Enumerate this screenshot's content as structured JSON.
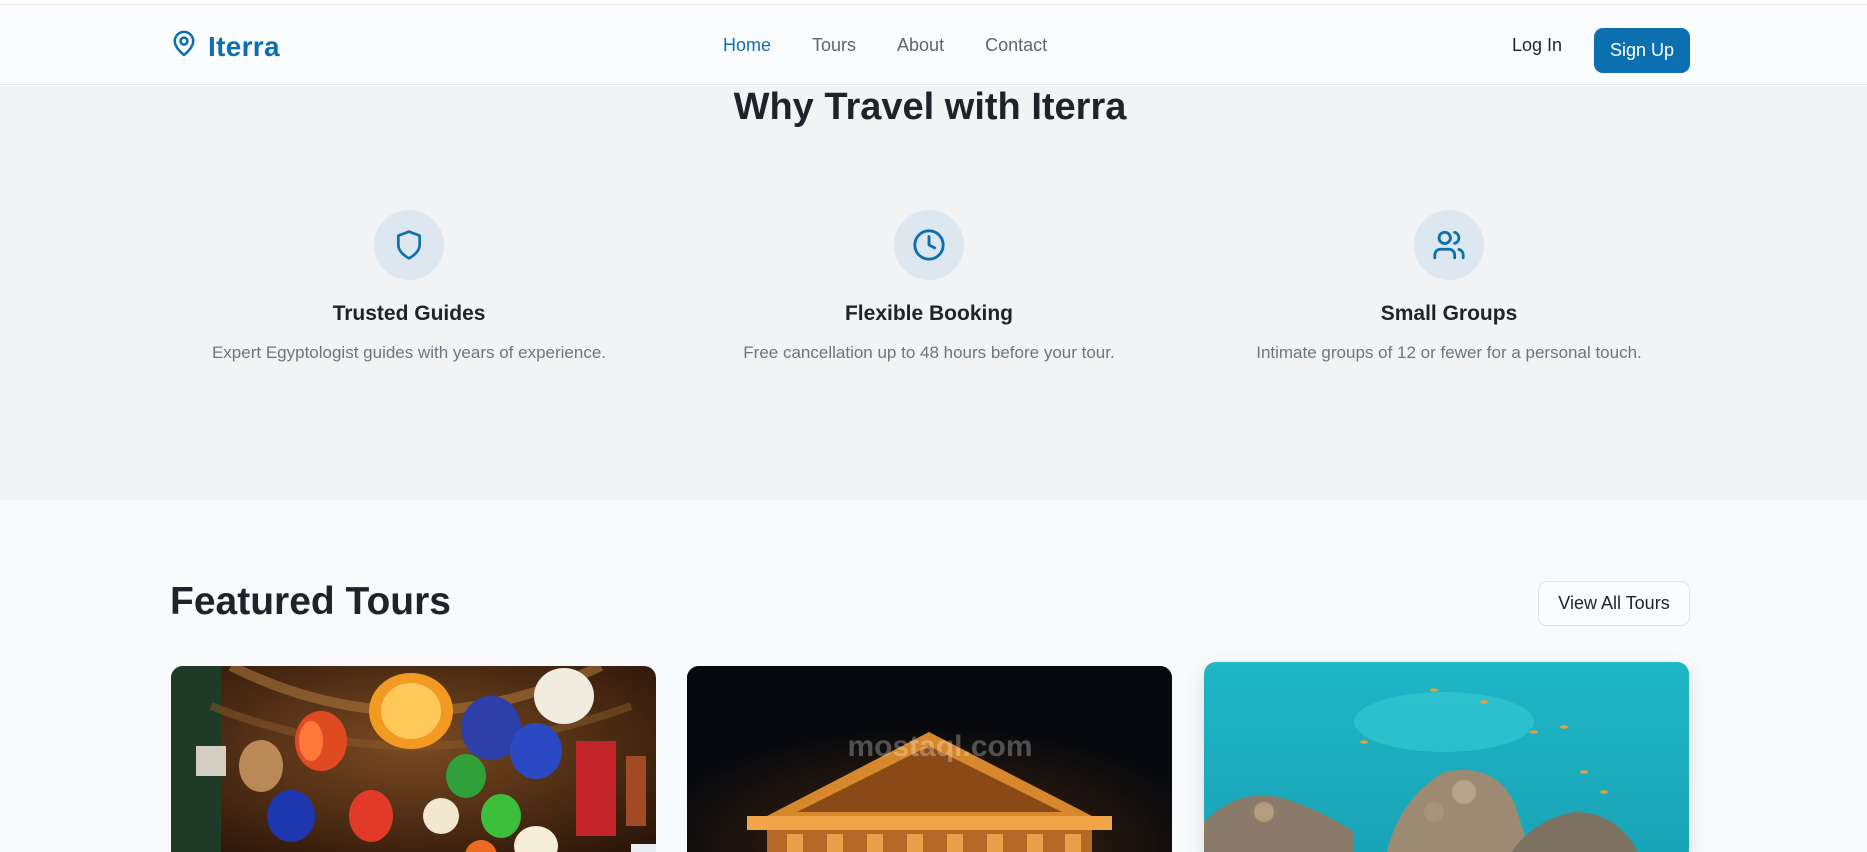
{
  "header": {
    "brand": "Iterra",
    "nav": [
      "Home",
      "Tours",
      "About",
      "Contact"
    ],
    "active_nav": "Home",
    "login_label": "Log In",
    "signup_label": "Sign Up",
    "accent_color": "#0c6fb0"
  },
  "why": {
    "title": "Why Travel with Iterra",
    "features": [
      {
        "icon": "shield-icon",
        "title": "Trusted Guides",
        "text": "Expert Egyptologist guides with years of experience."
      },
      {
        "icon": "clock-icon",
        "title": "Flexible Booking",
        "text": "Free cancellation up to 48 hours before your tour."
      },
      {
        "icon": "users-icon",
        "title": "Small Groups",
        "text": "Intimate groups of 12 or fewer for a personal touch."
      }
    ]
  },
  "featured": {
    "title": "Featured Tours",
    "view_all_label": "View All Tours",
    "watermark": "mostaql.com"
  }
}
